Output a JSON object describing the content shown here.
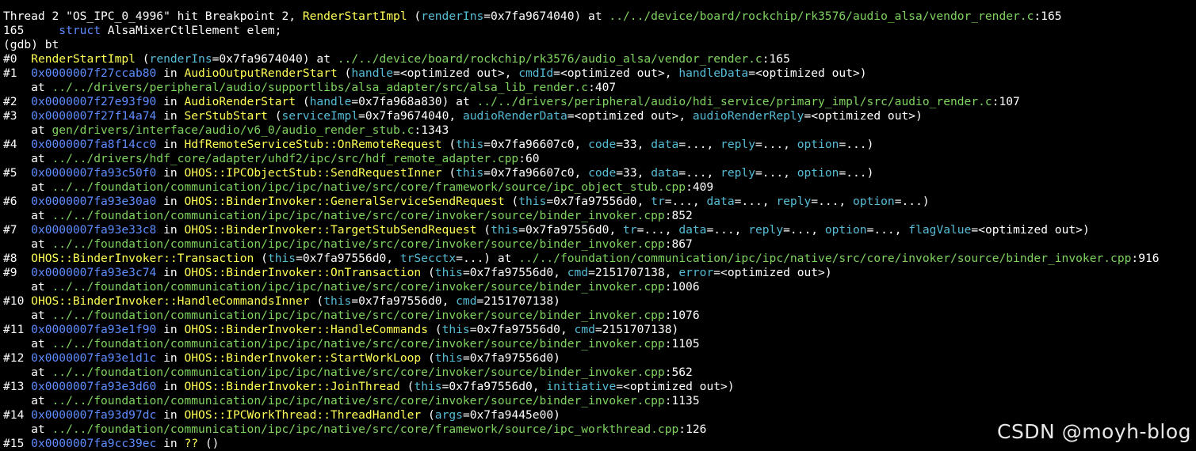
{
  "colors": {
    "background": "#000000",
    "default_text": "#ffffff",
    "function_name": "#ffff55",
    "argument_name": "#55bcd6",
    "address": "#5f8cff",
    "file_path": "#7fd35f",
    "watermark": "#e8e8e8"
  },
  "terminal": {
    "lines": [
      {
        "segments": [
          {
            "t": "Thread 2 \"OS_IPC_0_4996\" hit Breakpoint 2, ",
            "c": "white"
          },
          {
            "t": "RenderStartImpl",
            "c": "yellow"
          },
          {
            "t": " (",
            "c": "white"
          },
          {
            "t": "renderIns",
            "c": "cyan"
          },
          {
            "t": "=0x7fa9674040) at ",
            "c": "white"
          },
          {
            "t": "../../device/board/rockchip/rk3576/audio_alsa/vendor_render.c",
            "c": "green"
          },
          {
            "t": ":165",
            "c": "white"
          }
        ]
      },
      {
        "segments": [
          {
            "t": "165\t",
            "c": "white"
          },
          {
            "t": "struct",
            "c": "blue"
          },
          {
            "t": " AlsaMixerCtlElement elem;",
            "c": "white"
          }
        ]
      },
      {
        "segments": [
          {
            "t": "(gdb) bt",
            "c": "white"
          }
        ]
      },
      {
        "segments": [
          {
            "t": "#0  ",
            "c": "white"
          },
          {
            "t": "RenderStartImpl",
            "c": "yellow"
          },
          {
            "t": " (",
            "c": "white"
          },
          {
            "t": "renderIns",
            "c": "cyan"
          },
          {
            "t": "=0x7fa9674040) at ",
            "c": "white"
          },
          {
            "t": "../../device/board/rockchip/rk3576/audio_alsa/vendor_render.c",
            "c": "green"
          },
          {
            "t": ":165",
            "c": "white"
          }
        ]
      },
      {
        "segments": [
          {
            "t": "#1  ",
            "c": "white"
          },
          {
            "t": "0x0000007f27ccab80",
            "c": "blue"
          },
          {
            "t": " in ",
            "c": "white"
          },
          {
            "t": "AudioOutputRenderStart",
            "c": "yellow"
          },
          {
            "t": " (",
            "c": "white"
          },
          {
            "t": "handle",
            "c": "cyan"
          },
          {
            "t": "=<optimized out>, ",
            "c": "white"
          },
          {
            "t": "cmdId",
            "c": "cyan"
          },
          {
            "t": "=<optimized out>, ",
            "c": "white"
          },
          {
            "t": "handleData",
            "c": "cyan"
          },
          {
            "t": "=<optimized out>)",
            "c": "white"
          }
        ]
      },
      {
        "segments": [
          {
            "t": "    at ",
            "c": "white"
          },
          {
            "t": "../../drivers/peripheral/audio/supportlibs/alsa_adapter/src/alsa_lib_render.c",
            "c": "green"
          },
          {
            "t": ":407",
            "c": "white"
          }
        ]
      },
      {
        "segments": [
          {
            "t": "#2  ",
            "c": "white"
          },
          {
            "t": "0x0000007f27e93f90",
            "c": "blue"
          },
          {
            "t": " in ",
            "c": "white"
          },
          {
            "t": "AudioRenderStart",
            "c": "yellow"
          },
          {
            "t": " (",
            "c": "white"
          },
          {
            "t": "handle",
            "c": "cyan"
          },
          {
            "t": "=0x7fa968a830) at ",
            "c": "white"
          },
          {
            "t": "../../drivers/peripheral/audio/hdi_service/primary_impl/src/audio_render.c",
            "c": "green"
          },
          {
            "t": ":107",
            "c": "white"
          }
        ]
      },
      {
        "segments": [
          {
            "t": "#3  ",
            "c": "white"
          },
          {
            "t": "0x0000007f27f14a74",
            "c": "blue"
          },
          {
            "t": " in ",
            "c": "white"
          },
          {
            "t": "SerStubStart",
            "c": "yellow"
          },
          {
            "t": " (",
            "c": "white"
          },
          {
            "t": "serviceImpl",
            "c": "cyan"
          },
          {
            "t": "=0x7fa9674040, ",
            "c": "white"
          },
          {
            "t": "audioRenderData",
            "c": "cyan"
          },
          {
            "t": "=<optimized out>, ",
            "c": "white"
          },
          {
            "t": "audioRenderReply",
            "c": "cyan"
          },
          {
            "t": "=<optimized out>)",
            "c": "white"
          }
        ]
      },
      {
        "segments": [
          {
            "t": "    at ",
            "c": "white"
          },
          {
            "t": "gen/drivers/interface/audio/v6_0/audio_render_stub.c",
            "c": "green"
          },
          {
            "t": ":1343",
            "c": "white"
          }
        ]
      },
      {
        "segments": [
          {
            "t": "#4  ",
            "c": "white"
          },
          {
            "t": "0x0000007fa8f14cc0",
            "c": "blue"
          },
          {
            "t": " in ",
            "c": "white"
          },
          {
            "t": "HdfRemoteServiceStub::OnRemoteRequest",
            "c": "yellow"
          },
          {
            "t": " (",
            "c": "white"
          },
          {
            "t": "this",
            "c": "cyan"
          },
          {
            "t": "=0x7fa96607c0, ",
            "c": "white"
          },
          {
            "t": "code",
            "c": "cyan"
          },
          {
            "t": "=33, ",
            "c": "white"
          },
          {
            "t": "data",
            "c": "cyan"
          },
          {
            "t": "=..., ",
            "c": "white"
          },
          {
            "t": "reply",
            "c": "cyan"
          },
          {
            "t": "=..., ",
            "c": "white"
          },
          {
            "t": "option",
            "c": "cyan"
          },
          {
            "t": "=...)",
            "c": "white"
          }
        ]
      },
      {
        "segments": [
          {
            "t": "    at ",
            "c": "white"
          },
          {
            "t": "../../drivers/hdf_core/adapter/uhdf2/ipc/src/hdf_remote_adapter.cpp",
            "c": "green"
          },
          {
            "t": ":60",
            "c": "white"
          }
        ]
      },
      {
        "segments": [
          {
            "t": "#5  ",
            "c": "white"
          },
          {
            "t": "0x0000007fa93c50f0",
            "c": "blue"
          },
          {
            "t": " in ",
            "c": "white"
          },
          {
            "t": "OHOS::IPCObjectStub::SendRequestInner",
            "c": "yellow"
          },
          {
            "t": " (",
            "c": "white"
          },
          {
            "t": "this",
            "c": "cyan"
          },
          {
            "t": "=0x7fa96607c0, ",
            "c": "white"
          },
          {
            "t": "code",
            "c": "cyan"
          },
          {
            "t": "=33, ",
            "c": "white"
          },
          {
            "t": "data",
            "c": "cyan"
          },
          {
            "t": "=..., ",
            "c": "white"
          },
          {
            "t": "reply",
            "c": "cyan"
          },
          {
            "t": "=..., ",
            "c": "white"
          },
          {
            "t": "option",
            "c": "cyan"
          },
          {
            "t": "=...)",
            "c": "white"
          }
        ]
      },
      {
        "segments": [
          {
            "t": "    at ",
            "c": "white"
          },
          {
            "t": "../../foundation/communication/ipc/ipc/native/src/core/framework/source/ipc_object_stub.cpp",
            "c": "green"
          },
          {
            "t": ":409",
            "c": "white"
          }
        ]
      },
      {
        "segments": [
          {
            "t": "#6  ",
            "c": "white"
          },
          {
            "t": "0x0000007fa93e30a0",
            "c": "blue"
          },
          {
            "t": " in ",
            "c": "white"
          },
          {
            "t": "OHOS::BinderInvoker::GeneralServiceSendRequest",
            "c": "yellow"
          },
          {
            "t": " (",
            "c": "white"
          },
          {
            "t": "this",
            "c": "cyan"
          },
          {
            "t": "=0x7fa97556d0, ",
            "c": "white"
          },
          {
            "t": "tr",
            "c": "cyan"
          },
          {
            "t": "=..., ",
            "c": "white"
          },
          {
            "t": "data",
            "c": "cyan"
          },
          {
            "t": "=..., ",
            "c": "white"
          },
          {
            "t": "reply",
            "c": "cyan"
          },
          {
            "t": "=..., ",
            "c": "white"
          },
          {
            "t": "option",
            "c": "cyan"
          },
          {
            "t": "=...)",
            "c": "white"
          }
        ]
      },
      {
        "segments": [
          {
            "t": "    at ",
            "c": "white"
          },
          {
            "t": "../../foundation/communication/ipc/ipc/native/src/core/invoker/source/binder_invoker.cpp",
            "c": "green"
          },
          {
            "t": ":852",
            "c": "white"
          }
        ]
      },
      {
        "segments": [
          {
            "t": "#7  ",
            "c": "white"
          },
          {
            "t": "0x0000007fa93e33c8",
            "c": "blue"
          },
          {
            "t": " in ",
            "c": "white"
          },
          {
            "t": "OHOS::BinderInvoker::TargetStubSendRequest",
            "c": "yellow"
          },
          {
            "t": " (",
            "c": "white"
          },
          {
            "t": "this",
            "c": "cyan"
          },
          {
            "t": "=0x7fa97556d0, ",
            "c": "white"
          },
          {
            "t": "tr",
            "c": "cyan"
          },
          {
            "t": "=..., ",
            "c": "white"
          },
          {
            "t": "data",
            "c": "cyan"
          },
          {
            "t": "=..., ",
            "c": "white"
          },
          {
            "t": "reply",
            "c": "cyan"
          },
          {
            "t": "=..., ",
            "c": "white"
          },
          {
            "t": "option",
            "c": "cyan"
          },
          {
            "t": "=..., ",
            "c": "white"
          },
          {
            "t": "flagValue",
            "c": "cyan"
          },
          {
            "t": "=<optimized out>)",
            "c": "white"
          }
        ]
      },
      {
        "segments": [
          {
            "t": "    at ",
            "c": "white"
          },
          {
            "t": "../../foundation/communication/ipc/ipc/native/src/core/invoker/source/binder_invoker.cpp",
            "c": "green"
          },
          {
            "t": ":867",
            "c": "white"
          }
        ]
      },
      {
        "segments": [
          {
            "t": "#8  ",
            "c": "white"
          },
          {
            "t": "OHOS::BinderInvoker::Transaction",
            "c": "yellow"
          },
          {
            "t": " (",
            "c": "white"
          },
          {
            "t": "this",
            "c": "cyan"
          },
          {
            "t": "=0x7fa97556d0, ",
            "c": "white"
          },
          {
            "t": "trSecctx",
            "c": "cyan"
          },
          {
            "t": "=...) at ",
            "c": "white"
          },
          {
            "t": "../../foundation/communication/ipc/ipc/native/src/core/invoker/source/binder_invoker.cpp",
            "c": "green"
          },
          {
            "t": ":916",
            "c": "white"
          }
        ]
      },
      {
        "segments": [
          {
            "t": "#9  ",
            "c": "white"
          },
          {
            "t": "0x0000007fa93e3c74",
            "c": "blue"
          },
          {
            "t": " in ",
            "c": "white"
          },
          {
            "t": "OHOS::BinderInvoker::OnTransaction",
            "c": "yellow"
          },
          {
            "t": " (",
            "c": "white"
          },
          {
            "t": "this",
            "c": "cyan"
          },
          {
            "t": "=0x7fa97556d0, ",
            "c": "white"
          },
          {
            "t": "cmd",
            "c": "cyan"
          },
          {
            "t": "=2151707138, ",
            "c": "white"
          },
          {
            "t": "error",
            "c": "cyan"
          },
          {
            "t": "=<optimized out>)",
            "c": "white"
          }
        ]
      },
      {
        "segments": [
          {
            "t": "    at ",
            "c": "white"
          },
          {
            "t": "../../foundation/communication/ipc/ipc/native/src/core/invoker/source/binder_invoker.cpp",
            "c": "green"
          },
          {
            "t": ":1006",
            "c": "white"
          }
        ]
      },
      {
        "segments": [
          {
            "t": "#10 ",
            "c": "white"
          },
          {
            "t": "OHOS::BinderInvoker::HandleCommandsInner",
            "c": "yellow"
          },
          {
            "t": " (",
            "c": "white"
          },
          {
            "t": "this",
            "c": "cyan"
          },
          {
            "t": "=0x7fa97556d0, ",
            "c": "white"
          },
          {
            "t": "cmd",
            "c": "cyan"
          },
          {
            "t": "=2151707138)",
            "c": "white"
          }
        ]
      },
      {
        "segments": [
          {
            "t": "    at ",
            "c": "white"
          },
          {
            "t": "../../foundation/communication/ipc/ipc/native/src/core/invoker/source/binder_invoker.cpp",
            "c": "green"
          },
          {
            "t": ":1076",
            "c": "white"
          }
        ]
      },
      {
        "segments": [
          {
            "t": "#11 ",
            "c": "white"
          },
          {
            "t": "0x0000007fa93e1f90",
            "c": "blue"
          },
          {
            "t": " in ",
            "c": "white"
          },
          {
            "t": "OHOS::BinderInvoker::HandleCommands",
            "c": "yellow"
          },
          {
            "t": " (",
            "c": "white"
          },
          {
            "t": "this",
            "c": "cyan"
          },
          {
            "t": "=0x7fa97556d0, ",
            "c": "white"
          },
          {
            "t": "cmd",
            "c": "cyan"
          },
          {
            "t": "=2151707138)",
            "c": "white"
          }
        ]
      },
      {
        "segments": [
          {
            "t": "    at ",
            "c": "white"
          },
          {
            "t": "../../foundation/communication/ipc/ipc/native/src/core/invoker/source/binder_invoker.cpp",
            "c": "green"
          },
          {
            "t": ":1105",
            "c": "white"
          }
        ]
      },
      {
        "segments": [
          {
            "t": "#12 ",
            "c": "white"
          },
          {
            "t": "0x0000007fa93e1d1c",
            "c": "blue"
          },
          {
            "t": " in ",
            "c": "white"
          },
          {
            "t": "OHOS::BinderInvoker::StartWorkLoop",
            "c": "yellow"
          },
          {
            "t": " (",
            "c": "white"
          },
          {
            "t": "this",
            "c": "cyan"
          },
          {
            "t": "=0x7fa97556d0)",
            "c": "white"
          }
        ]
      },
      {
        "segments": [
          {
            "t": "    at ",
            "c": "white"
          },
          {
            "t": "../../foundation/communication/ipc/ipc/native/src/core/invoker/source/binder_invoker.cpp",
            "c": "green"
          },
          {
            "t": ":562",
            "c": "white"
          }
        ]
      },
      {
        "segments": [
          {
            "t": "#13 ",
            "c": "white"
          },
          {
            "t": "0x0000007fa93e3d60",
            "c": "blue"
          },
          {
            "t": " in ",
            "c": "white"
          },
          {
            "t": "OHOS::BinderInvoker::JoinThread",
            "c": "yellow"
          },
          {
            "t": " (",
            "c": "white"
          },
          {
            "t": "this",
            "c": "cyan"
          },
          {
            "t": "=0x7fa97556d0, ",
            "c": "white"
          },
          {
            "t": "initiative",
            "c": "cyan"
          },
          {
            "t": "=<optimized out>)",
            "c": "white"
          }
        ]
      },
      {
        "segments": [
          {
            "t": "    at ",
            "c": "white"
          },
          {
            "t": "../../foundation/communication/ipc/ipc/native/src/core/invoker/source/binder_invoker.cpp",
            "c": "green"
          },
          {
            "t": ":1135",
            "c": "white"
          }
        ]
      },
      {
        "segments": [
          {
            "t": "#14 ",
            "c": "white"
          },
          {
            "t": "0x0000007fa93d97dc",
            "c": "blue"
          },
          {
            "t": " in ",
            "c": "white"
          },
          {
            "t": "OHOS::IPCWorkThread::ThreadHandler",
            "c": "yellow"
          },
          {
            "t": " (",
            "c": "white"
          },
          {
            "t": "args",
            "c": "cyan"
          },
          {
            "t": "=0x7fa9445e00)",
            "c": "white"
          }
        ]
      },
      {
        "segments": [
          {
            "t": "    at ",
            "c": "white"
          },
          {
            "t": "../../foundation/communication/ipc/ipc/native/src/core/framework/source/ipc_workthread.cpp",
            "c": "green"
          },
          {
            "t": ":126",
            "c": "white"
          }
        ]
      },
      {
        "segments": [
          {
            "t": "#15 ",
            "c": "white"
          },
          {
            "t": "0x0000007fa9cc39ec",
            "c": "blue"
          },
          {
            "t": " in ",
            "c": "white"
          },
          {
            "t": "??",
            "c": "yellow"
          },
          {
            "t": " ()",
            "c": "white"
          }
        ]
      }
    ]
  },
  "watermark": {
    "text": "CSDN @moyh-blog"
  }
}
